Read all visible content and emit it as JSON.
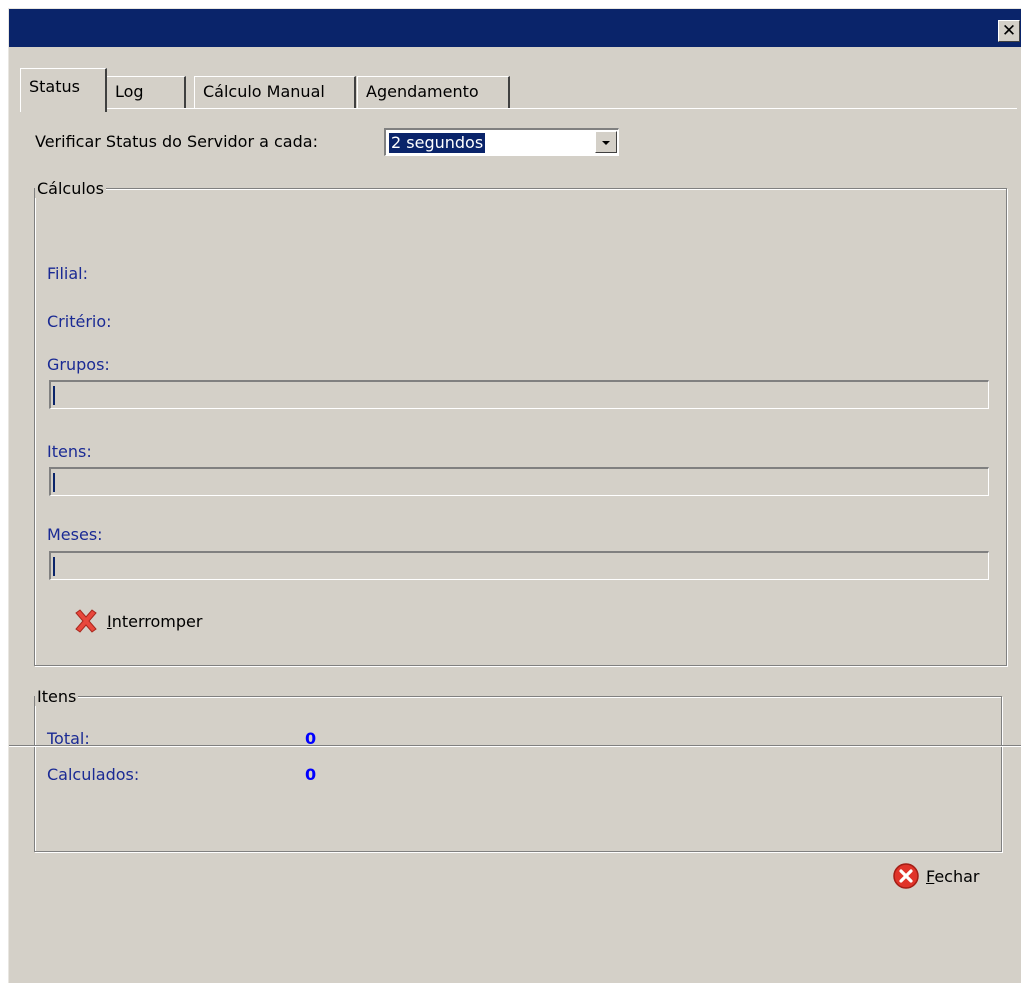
{
  "window": {
    "close_glyph": "✕"
  },
  "tabs": [
    {
      "label": "Status",
      "active": true
    },
    {
      "label": "Log",
      "active": false
    },
    {
      "label": "Cálculo Manual",
      "active": false
    },
    {
      "label": "Agendamento",
      "active": false
    }
  ],
  "status": {
    "interval_label": "Verificar Status do Servidor a cada:",
    "interval_value": "2 segundos",
    "calculos": {
      "title": "Cálculos",
      "filial_label": "Filial:",
      "criterio_label": "Critério:",
      "grupos_label": "Grupos:",
      "grupos_progress": 0,
      "itens_label": "Itens:",
      "itens_progress": 0,
      "meses_label": "Meses:",
      "meses_progress": 0,
      "interrupt_label_first": "I",
      "interrupt_label_rest": "nterromper",
      "interrupt_icon": "cancel-x-icon"
    },
    "itens": {
      "title": "Itens",
      "total_label": "Total:",
      "total_value": "0",
      "calculados_label": "Calculados:",
      "calculados_value": "0"
    }
  },
  "footer": {
    "close_label_first": "F",
    "close_label_rest": "echar",
    "close_icon": "close-circle-icon"
  },
  "colors": {
    "titlebar": "#0a246a",
    "window_bg": "#d4d0c8",
    "label_blue": "#1a2a94",
    "value_blue": "#0000ff"
  }
}
